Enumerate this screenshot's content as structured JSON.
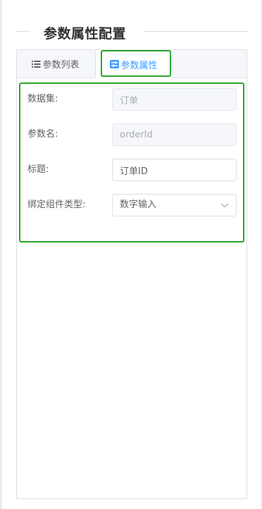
{
  "section": {
    "title": "参数属性配置"
  },
  "tabs": [
    {
      "label": "参数列表",
      "icon": "list-icon",
      "active": false
    },
    {
      "label": "参数属性",
      "icon": "settings-sliders-icon",
      "active": true
    }
  ],
  "form": {
    "dataset": {
      "label": "数据集:",
      "value": "订单",
      "disabled": true
    },
    "param_name": {
      "label": "参数名:",
      "value": "orderId",
      "disabled": true
    },
    "title": {
      "label": "标题:",
      "value": "订单ID",
      "disabled": false
    },
    "component_type": {
      "label": "绑定组件类型:",
      "value": "数字输入",
      "icon": "chevron-down-icon"
    }
  },
  "colors": {
    "accent": "#409eff",
    "highlight": "#2aa52a",
    "text": "#606266",
    "heading": "#303133"
  }
}
